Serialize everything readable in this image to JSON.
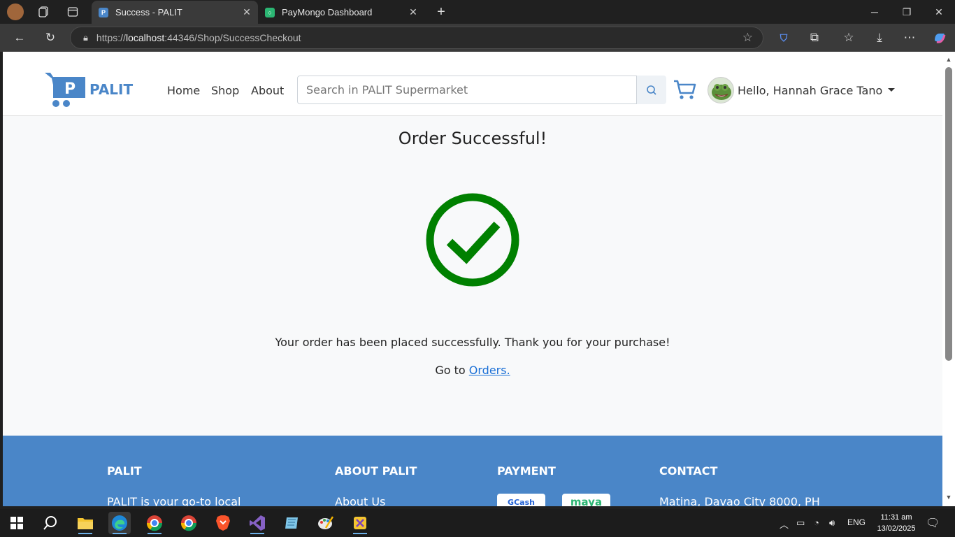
{
  "browser": {
    "tabs": [
      {
        "label": "Success - PALIT",
        "active": true,
        "favicon": "palit-favicon"
      },
      {
        "label": "PayMongo Dashboard",
        "active": false,
        "favicon": "paymongo-favicon"
      }
    ],
    "url": {
      "protocol": "https://",
      "host": "localhost",
      "rest": ":44346/Shop/SuccessCheckout"
    }
  },
  "nav": {
    "brand": "PALIT",
    "links": [
      "Home",
      "Shop",
      "About"
    ],
    "search_placeholder": "Search in PALIT Supermarket",
    "greeting": "Hello, Hannah Grace Tano"
  },
  "main": {
    "title": "Order Successful!",
    "message": "Your order has been placed successfully. Thank you for your purchase!",
    "goto_prefix": "Go to",
    "goto_link": "Orders."
  },
  "footer": {
    "columns": [
      {
        "heading": "PALIT",
        "text": "PALIT is your go-to local"
      },
      {
        "heading": "ABOUT PALIT",
        "text": "About Us"
      },
      {
        "heading": "PAYMENT",
        "logos": [
          "GCash",
          "maya"
        ]
      },
      {
        "heading": "CONTACT",
        "text": "Matina, Davao City 8000, PH"
      }
    ]
  },
  "taskbar": {
    "language": "ENG",
    "time": "11:31 am",
    "date": "13/02/2025"
  },
  "colors": {
    "brand": "#4a86c8",
    "success": "#008000",
    "link": "#1a6fd6"
  }
}
